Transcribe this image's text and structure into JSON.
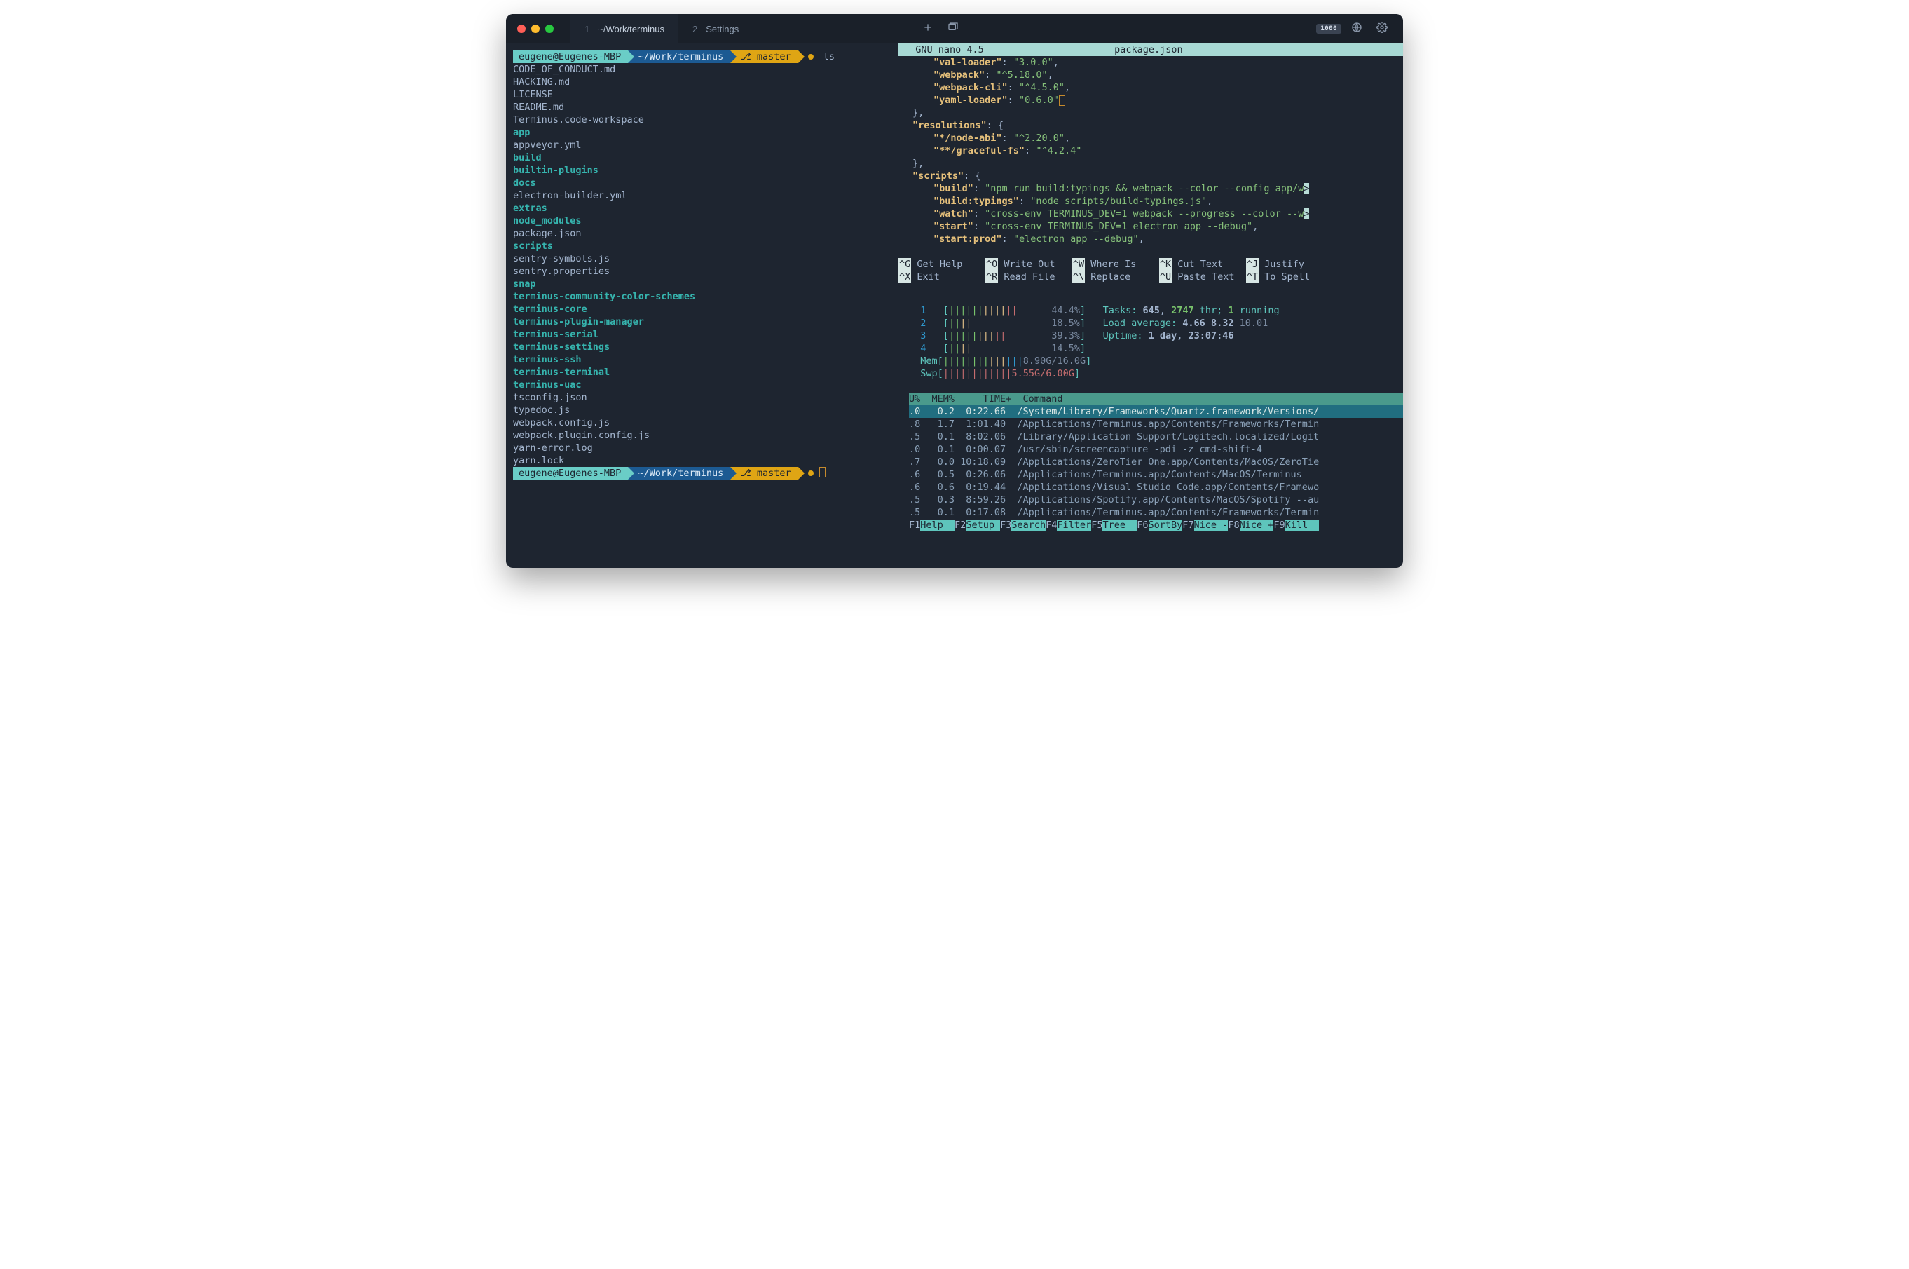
{
  "titlebar": {
    "tabs": [
      {
        "num": "1",
        "label": "~/Work/terminus"
      },
      {
        "num": "2",
        "label": "Settings"
      }
    ],
    "kbd_badge": "1000"
  },
  "prompt": {
    "user": "eugene@Eugenes-MBP",
    "path": "~/Work/terminus",
    "branch": "⎇ master",
    "cmd": "ls"
  },
  "ls": [
    {
      "t": "CODE_OF_CONDUCT.md",
      "d": false
    },
    {
      "t": "HACKING.md",
      "d": false
    },
    {
      "t": "LICENSE",
      "d": false
    },
    {
      "t": "README.md",
      "d": false
    },
    {
      "t": "Terminus.code-workspace",
      "d": false
    },
    {
      "t": "app",
      "d": true
    },
    {
      "t": "appveyor.yml",
      "d": false
    },
    {
      "t": "build",
      "d": true
    },
    {
      "t": "builtin-plugins",
      "d": true
    },
    {
      "t": "docs",
      "d": true
    },
    {
      "t": "electron-builder.yml",
      "d": false
    },
    {
      "t": "extras",
      "d": true
    },
    {
      "t": "node_modules",
      "d": true
    },
    {
      "t": "package.json",
      "d": false
    },
    {
      "t": "scripts",
      "d": true
    },
    {
      "t": "sentry-symbols.js",
      "d": false
    },
    {
      "t": "sentry.properties",
      "d": false
    },
    {
      "t": "snap",
      "d": true
    },
    {
      "t": "terminus-community-color-schemes",
      "d": true
    },
    {
      "t": "terminus-core",
      "d": true
    },
    {
      "t": "terminus-plugin-manager",
      "d": true
    },
    {
      "t": "terminus-serial",
      "d": true
    },
    {
      "t": "terminus-settings",
      "d": true
    },
    {
      "t": "terminus-ssh",
      "d": true
    },
    {
      "t": "terminus-terminal",
      "d": true
    },
    {
      "t": "terminus-uac",
      "d": true
    },
    {
      "t": "tsconfig.json",
      "d": false
    },
    {
      "t": "typedoc.js",
      "d": false
    },
    {
      "t": "webpack.config.js",
      "d": false
    },
    {
      "t": "webpack.plugin.config.js",
      "d": false
    },
    {
      "t": "yarn-error.log",
      "d": false
    },
    {
      "t": "yarn.lock",
      "d": false
    }
  ],
  "nano": {
    "title": "  GNU nano 4.5",
    "file": "package.json",
    "deps": [
      {
        "k": "\"val-loader\"",
        "v": "\"3.0.0\"",
        "comma": ","
      },
      {
        "k": "\"webpack\"",
        "v": "\"^5.18.0\"",
        "comma": ","
      },
      {
        "k": "\"webpack-cli\"",
        "v": "\"^4.5.0\"",
        "comma": ","
      },
      {
        "k": "\"yaml-loader\"",
        "v": "\"0.6.0\"",
        "comma": ""
      }
    ],
    "close1": "},",
    "res_key": "\"resolutions\"",
    "resolutions": [
      {
        "k": "\"*/node-abi\"",
        "v": "\"^2.20.0\"",
        "comma": ","
      },
      {
        "k": "\"**/graceful-fs\"",
        "v": "\"^4.2.4\"",
        "comma": ""
      }
    ],
    "close2": "},",
    "scr_key": "\"scripts\"",
    "scripts": [
      {
        "k": "\"build\"",
        "v": "\"npm run build:typings && webpack --color --config app/w",
        "trunc": true
      },
      {
        "k": "\"build:typings\"",
        "v": "\"node scripts/build-typings.js\"",
        "comma": ","
      },
      {
        "k": "\"watch\"",
        "v": "\"cross-env TERMINUS_DEV=1 webpack --progress --color --w",
        "trunc": true
      },
      {
        "k": "\"start\"",
        "v": "\"cross-env TERMINUS_DEV=1 electron app --debug\"",
        "comma": ","
      },
      {
        "k": "\"start:prod\"",
        "v": "\"electron app --debug\"",
        "comma": ","
      }
    ],
    "hotkeys": [
      [
        [
          "^G",
          "Get Help"
        ],
        [
          "^O",
          "Write Out"
        ],
        [
          "^W",
          "Where Is"
        ],
        [
          "^K",
          "Cut Text"
        ],
        [
          "^J",
          "Justify"
        ]
      ],
      [
        [
          "^X",
          "Exit"
        ],
        [
          "^R",
          "Read File"
        ],
        [
          "^\\",
          "Replace"
        ],
        [
          "^U",
          "Paste Text"
        ],
        [
          "^T",
          "To Spell"
        ]
      ]
    ]
  },
  "htop": {
    "cpus": [
      {
        "n": "1",
        "bar": "||||||||||||",
        "pct": "44.4%"
      },
      {
        "n": "2",
        "bar": "||||",
        "pct": "18.5%"
      },
      {
        "n": "3",
        "bar": "||||||||||",
        "pct": "39.3%"
      },
      {
        "n": "4",
        "bar": "||||",
        "pct": "14.5%"
      }
    ],
    "mem_label": "Mem",
    "mem_bar": "||||||||||||||",
    "mem_val": "8.90G/16.0G",
    "swp_label": "Swp",
    "swp_bar": "||||||||||||",
    "swp_val": "5.55G/6.00G",
    "tasks_label": "Tasks: ",
    "tasks": "645",
    "thr": "2747",
    "thr_lbl": " thr; ",
    "running": "1",
    "running_lbl": " running",
    "load_label": "Load average: ",
    "load1": "4.66",
    "load5": "8.32",
    "load15": "10.01",
    "uptime_label": "Uptime: ",
    "uptime": "1 day, 23:07:46",
    "header": "U%  MEM%     TIME+  Command",
    "rows": [
      {
        "u": ".0",
        "m": "0.2",
        "t": "0:22.66",
        "c": "/System/Library/Frameworks/Quartz.framework/Versions/",
        "sel": true
      },
      {
        "u": ".8",
        "m": "1.7",
        "t": "1:01.40",
        "c": "/Applications/Terminus.app/Contents/Frameworks/Termin"
      },
      {
        "u": ".5",
        "m": "0.1",
        "t": "8:02.06",
        "c": "/Library/Application Support/Logitech.localized/Logit"
      },
      {
        "u": ".0",
        "m": "0.1",
        "t": "0:00.07",
        "c": "/usr/sbin/screencapture -pdi -z cmd-shift-4"
      },
      {
        "u": ".7",
        "m": "0.0",
        "t": "10:18.09",
        "c": "/Applications/ZeroTier One.app/Contents/MacOS/ZeroTie"
      },
      {
        "u": ".6",
        "m": "0.5",
        "t": "0:26.06",
        "c": "/Applications/Terminus.app/Contents/MacOS/Terminus"
      },
      {
        "u": ".6",
        "m": "0.6",
        "t": "0:19.44",
        "c": "/Applications/Visual Studio Code.app/Contents/Framewo"
      },
      {
        "u": ".5",
        "m": "0.3",
        "t": "8:59.26",
        "c": "/Applications/Spotify.app/Contents/MacOS/Spotify --au"
      },
      {
        "u": ".5",
        "m": "0.1",
        "t": "0:17.08",
        "c": "/Applications/Terminus.app/Contents/Frameworks/Termin"
      }
    ],
    "fnkeys": [
      [
        "F1",
        "Help  "
      ],
      [
        "F2",
        "Setup "
      ],
      [
        "F3",
        "Search"
      ],
      [
        "F4",
        "Filter"
      ],
      [
        "F5",
        "Tree  "
      ],
      [
        "F6",
        "SortBy"
      ],
      [
        "F7",
        "Nice -"
      ],
      [
        "F8",
        "Nice +"
      ],
      [
        "F9",
        "Kill  "
      ]
    ]
  }
}
